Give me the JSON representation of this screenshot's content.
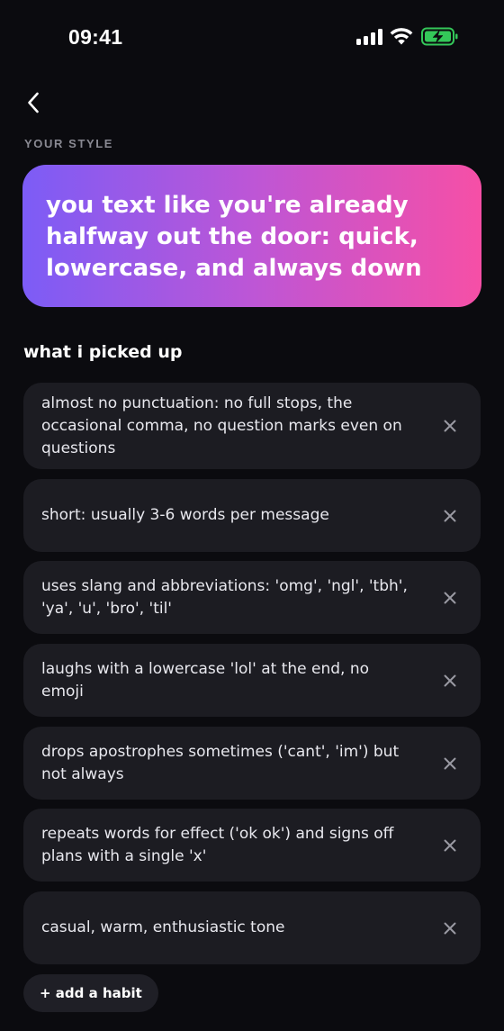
{
  "status_bar": {
    "time": "09:41"
  },
  "header": {
    "back_icon": "chevron-left-icon",
    "section_label": "YOUR STYLE"
  },
  "style_card": {
    "summary": "you text like you're already halfway out the door: quick, lowercase, and always down",
    "gradient_start": "#7c5cf6",
    "gradient_end": "#f64fa6"
  },
  "habits": {
    "heading": "what i picked up",
    "remove_icon": "close-icon",
    "items": [
      {
        "text": "almost no punctuation: no full stops, the occasional comma, no question marks even on questions"
      },
      {
        "text": "short: usually 3-6 words per message"
      },
      {
        "text": "uses slang and abbreviations: 'omg', 'ngl', 'tbh', 'ya', 'u', 'bro', 'til'"
      },
      {
        "text": "laughs with a lowercase 'lol' at the end, no emoji"
      },
      {
        "text": "drops apostrophes sometimes ('cant', 'im') but not always"
      },
      {
        "text": "repeats words for effect ('ok ok') and signs off plans with a single 'x'"
      },
      {
        "text": "casual, warm, enthusiastic tone"
      }
    ],
    "add_label": "+ add a habit"
  },
  "colors": {
    "background": "#0b0b0f",
    "card": "#1c1c22",
    "muted_text": "#8a8a93",
    "battery_green": "#34c759"
  }
}
